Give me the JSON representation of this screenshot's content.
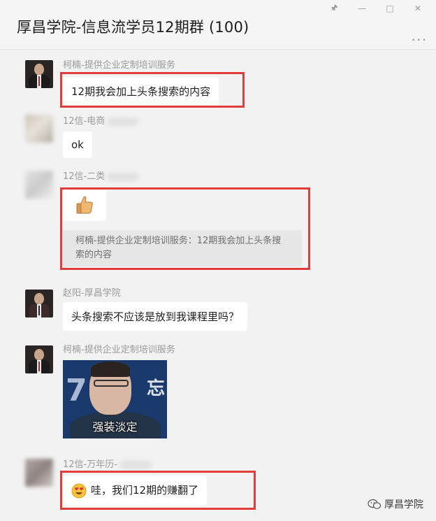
{
  "window": {
    "title": "厚昌学院-信息流学员12期群 (100)",
    "controls": [
      "pin-icon",
      "minimize-icon",
      "maximize-icon",
      "close-icon"
    ],
    "more_label": "..."
  },
  "messages": [
    {
      "sender": "柯楠-提供企业定制培训服务",
      "type": "text",
      "text": "12期我会加上头条搜索的内容",
      "highlighted": true
    },
    {
      "sender": "12信-电商",
      "type": "text",
      "text": "ok",
      "highlighted": false
    },
    {
      "sender": "12信-二类",
      "type": "emoji",
      "emoji": "thumbs-up-icon",
      "quote": "柯楠-提供企业定制培训服务：12期我会加上头条搜索的内容",
      "highlighted": true
    },
    {
      "sender": "赵阳-厚昌学院",
      "type": "text",
      "text": "头条搜索不应该是放到我课程里吗？",
      "highlighted": false
    },
    {
      "sender": "柯楠-提供企业定制培训服务",
      "type": "image",
      "caption": "强装淡定"
    },
    {
      "sender": "12信-万年历-",
      "type": "text",
      "emoji": "heart-eyes-icon",
      "text": "哇，我们12期的赚翻了",
      "highlighted": true
    }
  ],
  "watermark": {
    "text": "厚昌学院",
    "icon": "wechat-icon"
  },
  "colors": {
    "highlight_border": "#e23d3d",
    "background": "#f2f2f2",
    "bubble": "#ffffff"
  }
}
